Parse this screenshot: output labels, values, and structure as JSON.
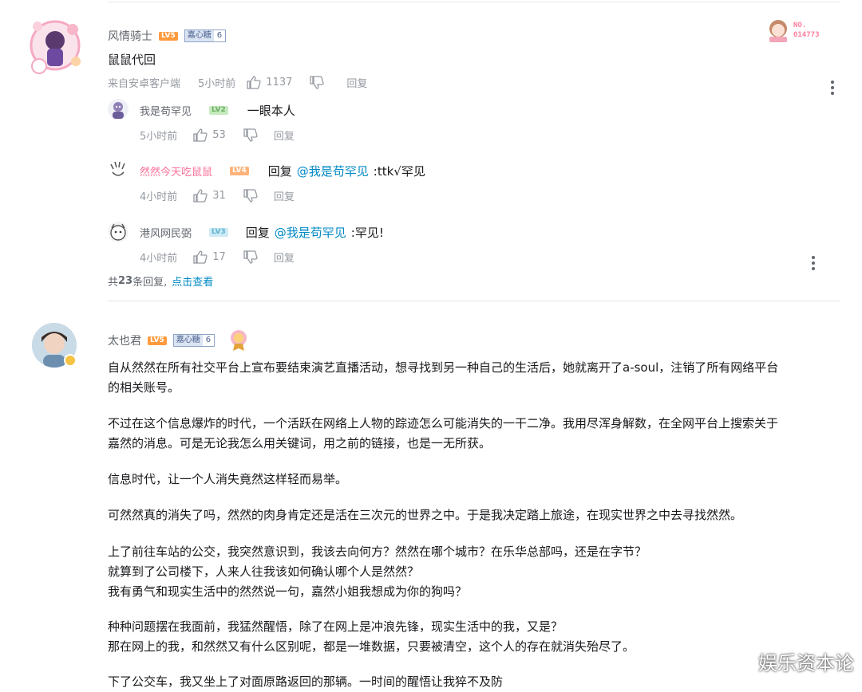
{
  "comment1": {
    "username": "风情骑士",
    "level": "LV5",
    "medal_name": "嘉心糖",
    "medal_level": "6",
    "text": "鼠鼠代回",
    "source": "来自安卓客户端",
    "time": "5小时前",
    "likes": "1137",
    "reply_label": "回复",
    "badge_title": "NO.",
    "badge_number": "014773",
    "replies": [
      {
        "username": "我是苟罕见",
        "level": "LV2",
        "text": "一眼本人",
        "time": "5小时前",
        "likes": "53",
        "reply_label": "回复"
      },
      {
        "username": "然然今天吃鼠鼠",
        "level": "LV4",
        "prefix": "回复",
        "mention": "@我是苟罕见",
        "text": ":ttk√罕见",
        "time": "4小时前",
        "likes": "31",
        "reply_label": "回复"
      },
      {
        "username": "港风网民弼",
        "level": "LV3",
        "prefix": "回复",
        "mention": "@我是苟罕见",
        "text": ":罕见!",
        "time": "4小时前",
        "likes": "17",
        "reply_label": "回复"
      }
    ],
    "total_prefix": "共",
    "total_count": "23",
    "total_suffix": "条回复,",
    "view_link": "点击查看"
  },
  "comment2": {
    "username": "太也君",
    "level": "LV5",
    "medal_name": "嘉心糖",
    "medal_level": "6",
    "paragraphs": [
      [
        "自从然然在所有社交平台上宣布要结束演艺直播活动，想寻找到另一种自己的生活后，她就离开了a-soul，注销了所有网络平台",
        "的相关账号。"
      ],
      [
        "不过在这个信息爆炸的时代，一个活跃在网络上人物的踪迹怎么可能消失的一干二净。我用尽浑身解数，在全网平台上搜索关于",
        "嘉然的消息。可是无论我怎么用关键词，用之前的链接，也是一无所获。"
      ],
      [
        "信息时代，让一个人消失竟然这样轻而易举。"
      ],
      [
        "可然然真的消失了吗，然然的肉身肯定还是活在三次元的世界之中。于是我决定踏上旅途，在现实世界之中去寻找然然。"
      ],
      [
        "上了前往车站的公交，我突然意识到，我该去向何方？然然在哪个城市？在乐华总部吗，还是在字节？",
        "就算到了公司楼下，人来人往我该如何确认哪个人是然然？",
        "我有勇气和现实生活中的然然说一句，嘉然小姐我想成为你的狗吗？"
      ],
      [
        "种种问题摆在我面前，我猛然醒悟，除了在网上是冲浪先锋，现实生活中的我，又是？",
        "那在网上的我，和然然又有什么区别呢，都是一堆数据，只要被清空，这个人的存在就消失殆尽了。"
      ],
      [
        "下了公交车，我又坐上了对面原路返回的那辆。一时间的醒悟让我猝不及防"
      ]
    ]
  },
  "watermark": "娱乐资本论",
  "colors": {
    "pink": "#fb7299",
    "blue": "#008ac5",
    "meta_gray": "#9499a0",
    "orange": "#ff9a3d"
  }
}
